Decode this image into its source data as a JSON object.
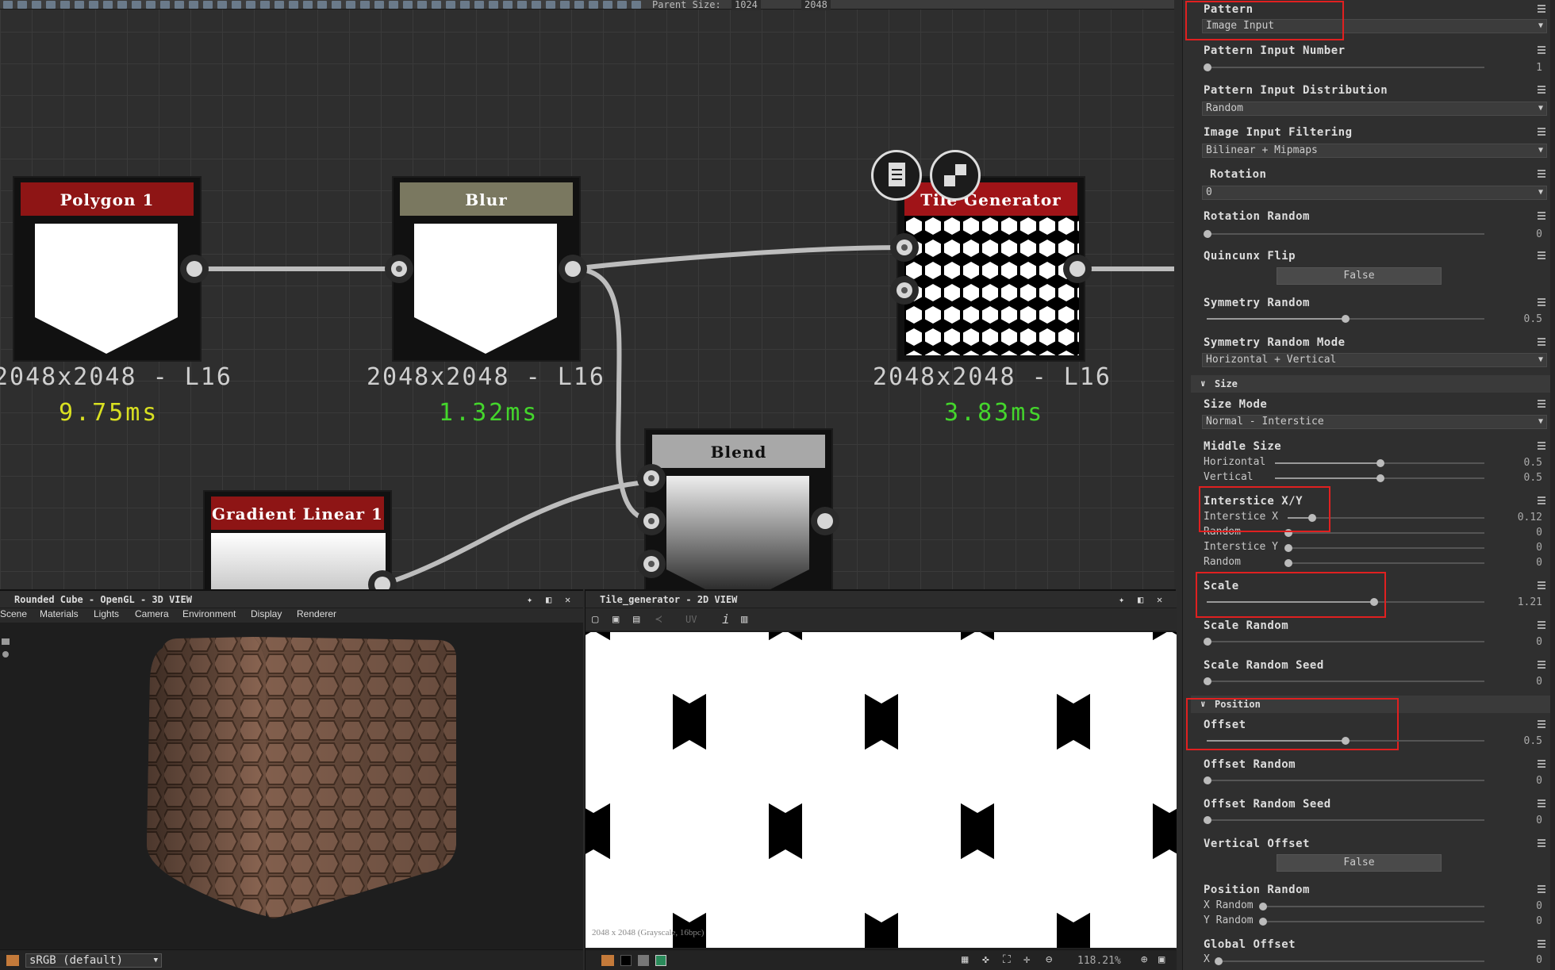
{
  "toolbar": {
    "parent_size_label": "Parent Size:",
    "parent_size": "1024",
    "output_size": "2048"
  },
  "graph": {
    "nodes": [
      {
        "title": "Polygon 1",
        "stat": "2048x2048 - L16",
        "time": "9.75ms",
        "head_color": "#8e1515",
        "time_color": "#d9e021"
      },
      {
        "title": "Blur",
        "stat": "2048x2048 - L16",
        "time": "1.32ms",
        "head_color": "#7a7860",
        "time_color": "#44d62c"
      },
      {
        "title": "Tile Generator",
        "stat": "2048x2048 - L16",
        "time": "3.83ms",
        "head_color": "#a01418",
        "time_color": "#44d62c"
      },
      {
        "title": "Blend",
        "head_color": "#a8a8a8"
      },
      {
        "title": "Gradient Linear 1",
        "head_color": "#8e1515"
      }
    ],
    "floating_icons": [
      "document-icon",
      "checker-icon"
    ]
  },
  "view3d": {
    "title": "Rounded Cube - OpenGL - 3D VIEW",
    "menu": [
      "Scene",
      "Materials",
      "Lights",
      "Camera",
      "Environment",
      "Display",
      "Renderer"
    ],
    "colorspace": "sRGB (default)"
  },
  "view2d": {
    "title": "Tile_generator - 2D VIEW",
    "uv_label": "UV",
    "info": "2048 x 2048 (Grayscale, 16bpc)",
    "zoom": "118.21%"
  },
  "panel": {
    "pattern": {
      "label": "Pattern",
      "value": "Image Input"
    },
    "pattern_input_number": {
      "label": "Pattern Input Number",
      "value": "1"
    },
    "pattern_input_distribution": {
      "label": "Pattern Input Distribution",
      "value": "Random"
    },
    "image_input_filtering": {
      "label": "Image Input Filtering",
      "value": "Bilinear + Mipmaps"
    },
    "rotation": {
      "label": "Rotation",
      "value": "0"
    },
    "rotation_random": {
      "label": "Rotation Random",
      "value": "0"
    },
    "quincunx_flip": {
      "label": "Quincunx Flip",
      "value": "False"
    },
    "symmetry_random": {
      "label": "Symmetry Random",
      "value": "0.5"
    },
    "symmetry_random_mode": {
      "label": "Symmetry Random Mode",
      "value": "Horizontal + Vertical"
    },
    "size_section": "Size",
    "size_mode": {
      "label": "Size Mode",
      "value": "Normal - Interstice"
    },
    "middle_size": {
      "label": "Middle Size",
      "h_label": "Horizontal",
      "h_value": "0.5",
      "v_label": "Vertical",
      "v_value": "0.5"
    },
    "interstice": {
      "label": "Interstice X/Y",
      "x_label": "Interstice X",
      "x_value": "0.12",
      "rx_label": "Random",
      "rx_value": "0",
      "y_label": "Interstice Y",
      "y_value": "0",
      "ry_label": "Random",
      "ry_value": "0"
    },
    "scale": {
      "label": "Scale",
      "value": "1.21"
    },
    "scale_random": {
      "label": "Scale Random",
      "value": "0"
    },
    "scale_random_seed": {
      "label": "Scale Random Seed",
      "value": "0"
    },
    "position_section": "Position",
    "offset": {
      "label": "Offset",
      "value": "0.5"
    },
    "offset_random": {
      "label": "Offset Random",
      "value": "0"
    },
    "offset_random_seed": {
      "label": "Offset Random Seed",
      "value": "0"
    },
    "vertical_offset": {
      "label": "Vertical Offset",
      "value": "False"
    },
    "position_random": {
      "label": "Position Random",
      "x_label": "X Random",
      "x_value": "0",
      "y_label": "Y Random",
      "y_value": "0"
    },
    "global_offset": {
      "label": "Global Offset",
      "x_label": "X",
      "x_value": "0"
    }
  },
  "colors": {
    "highlight": "#e02020",
    "node_bg": "#111111",
    "panel_bg": "#2f2f2f"
  }
}
